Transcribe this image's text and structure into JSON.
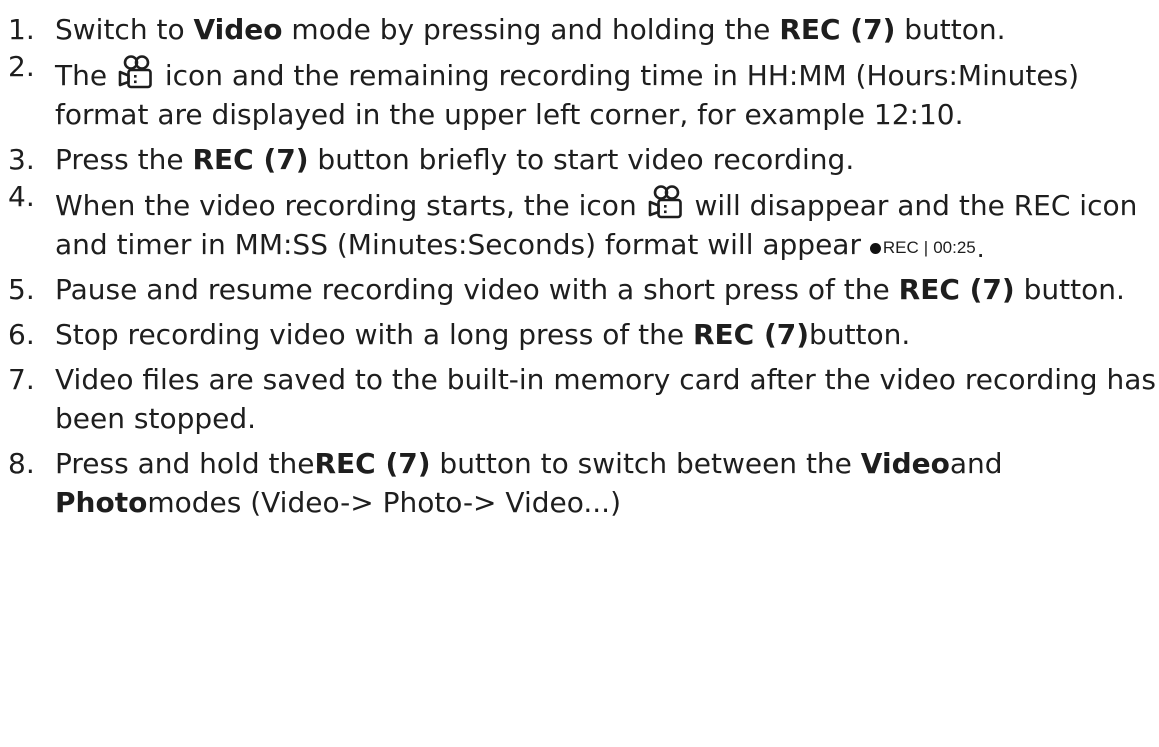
{
  "steps": [
    {
      "num": "1.",
      "parts": [
        {
          "t": "Switch to "
        },
        {
          "t": "Video",
          "b": true
        },
        {
          "t": " mode by pressing and holding the "
        },
        {
          "t": "REC (7)",
          "b": true
        },
        {
          "t": " button."
        }
      ]
    },
    {
      "num": "2.",
      "parts": [
        {
          "t": "The "
        },
        {
          "icon": "video-camera-icon"
        },
        {
          "t": " icon and the remaining recording time in HH:MM (Hours:Minutes) format are displayed in the upper left corner, for example 12:10."
        }
      ]
    },
    {
      "num": "3.",
      "parts": [
        {
          "t": "Press the "
        },
        {
          "t": "REC (7)",
          "b": true
        },
        {
          "t": " button briefly to start video recording."
        }
      ]
    },
    {
      "num": "4.",
      "parts": [
        {
          "t": "When the video recording starts, the icon "
        },
        {
          "icon": "video-camera-icon"
        },
        {
          "t": " will disappear and the REC icon and timer in MM:SS (Minutes:Seconds) format will appear "
        },
        {
          "badge": true
        }
      ]
    },
    {
      "num": "5.",
      "parts": [
        {
          "t": "Pause and resume recording video with a short press of the "
        },
        {
          "t": "REC (7)",
          "b": true
        },
        {
          "t": " button."
        }
      ]
    },
    {
      "num": "6.",
      "parts": [
        {
          "t": "Stop recording video with a long press of the "
        },
        {
          "t": "REC (7)",
          "b": true
        },
        {
          "t": "button."
        }
      ]
    },
    {
      "num": "7.",
      "parts": [
        {
          "t": "Video files are saved to the built-in memory card after the video recording has been stopped."
        }
      ]
    },
    {
      "num": "8.",
      "parts": [
        {
          "t": "Press and hold the"
        },
        {
          "t": "REC (7)",
          "b": true
        },
        {
          "t": " button to switch between the "
        },
        {
          "t": "Video",
          "b": true
        },
        {
          "t": "and "
        },
        {
          "t": "Photo",
          "b": true
        },
        {
          "t": "modes (Video-> Photo-> Video...)"
        }
      ]
    }
  ],
  "rec_badge": {
    "label": "REC",
    "separator": "|",
    "time": "00:25",
    "trailing": "."
  },
  "colors": {
    "text": "#1e1e1e",
    "background": "#ffffff"
  }
}
